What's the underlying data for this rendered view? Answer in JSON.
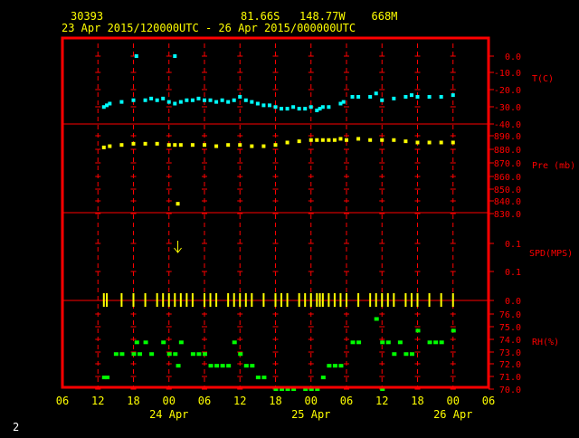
{
  "header": {
    "station": "30393",
    "location": "81.66S   148.77W    668M",
    "period": "23 Apr 2015/120000UTC - 26 Apr 2015/000000UTC"
  },
  "footer": {
    "page_number": "2"
  },
  "colors": {
    "frame": "#ff0000",
    "tick_text": "#ffff00",
    "panel_text": "#ff0000",
    "temperature": "#00ffff",
    "pressure": "#ffff00",
    "wind": "#ffff00",
    "humidity": "#00ff00"
  },
  "chart_data": {
    "type": "scatter",
    "x_unit": "hours since 2015-04-23 06:00 UTC",
    "x_ticks": [
      "06",
      "12",
      "18",
      "00",
      "06",
      "12",
      "18",
      "00",
      "06",
      "12",
      "18",
      "00",
      "06"
    ],
    "x_tick_hours": [
      0,
      6,
      12,
      18,
      24,
      30,
      36,
      42,
      48,
      54,
      60,
      66,
      72
    ],
    "date_labels": [
      {
        "label": "24 Apr",
        "hour": 18
      },
      {
        "label": "25 Apr",
        "hour": 42
      },
      {
        "label": "26 Apr",
        "hour": 66
      }
    ],
    "xlim": [
      0,
      72
    ],
    "panels": [
      {
        "id": "temperature",
        "ylabel": "T(C)",
        "ticks": [
          "0.0",
          "-10.0",
          "-20.0",
          "-30.0",
          "-40.0"
        ],
        "ylim": [
          0,
          -40
        ],
        "series": [
          {
            "color": "#00ffff",
            "points": [
              [
                7,
                -30
              ],
              [
                7.5,
                -29
              ],
              [
                8,
                -28
              ],
              [
                10,
                -27
              ],
              [
                12,
                -26
              ],
              [
                14,
                -26
              ],
              [
                15,
                -25
              ],
              [
                16,
                -26
              ],
              [
                17,
                -25
              ],
              [
                18,
                -27
              ],
              [
                19,
                -28
              ],
              [
                20,
                -27
              ],
              [
                21,
                -26
              ],
              [
                22,
                -26
              ],
              [
                23,
                -25
              ],
              [
                24,
                -26
              ],
              [
                25,
                -26
              ],
              [
                26,
                -27
              ],
              [
                27,
                -26
              ],
              [
                28,
                -27
              ],
              [
                29,
                -26
              ],
              [
                30,
                -24
              ],
              [
                31,
                -26
              ],
              [
                32,
                -27
              ],
              [
                33,
                -28
              ],
              [
                34,
                -29
              ],
              [
                35,
                -29
              ],
              [
                36,
                -30
              ],
              [
                37,
                -31
              ],
              [
                38,
                -31
              ],
              [
                39,
                -30
              ],
              [
                40,
                -31
              ],
              [
                41,
                -31
              ],
              [
                42,
                -30
              ],
              [
                43,
                -32
              ],
              [
                43.5,
                -31
              ],
              [
                44,
                -30
              ],
              [
                45,
                -30
              ],
              [
                47,
                -28
              ],
              [
                47.5,
                -27
              ],
              [
                49,
                -24
              ],
              [
                50,
                -24
              ],
              [
                52,
                -24
              ],
              [
                53,
                -22
              ],
              [
                54,
                -26
              ],
              [
                56,
                -25
              ],
              [
                58,
                -24
              ],
              [
                59,
                -23
              ],
              [
                60,
                -24
              ],
              [
                62,
                -24
              ],
              [
                64,
                -24
              ],
              [
                66,
                -23
              ],
              [
                12.5,
                0
              ],
              [
                19,
                0
              ]
            ]
          }
        ]
      },
      {
        "id": "pressure",
        "ylabel": "Pre (mb)",
        "ticks": [
          "890.0",
          "880.0",
          "870.0",
          "860.0",
          "850.0",
          "840.0",
          "830.0"
        ],
        "ylim": [
          830,
          895
        ],
        "series": [
          {
            "color": "#ffff00",
            "points": [
              [
                7,
                884
              ],
              [
                8,
                885
              ],
              [
                10,
                886
              ],
              [
                12,
                887
              ],
              [
                14,
                887
              ],
              [
                16,
                887
              ],
              [
                18,
                886
              ],
              [
                19,
                886
              ],
              [
                20,
                886
              ],
              [
                22,
                886
              ],
              [
                24,
                886
              ],
              [
                26,
                885
              ],
              [
                28,
                886
              ],
              [
                30,
                886
              ],
              [
                32,
                885
              ],
              [
                34,
                885
              ],
              [
                36,
                886
              ],
              [
                38,
                888
              ],
              [
                40,
                889
              ],
              [
                42,
                890
              ],
              [
                43,
                890
              ],
              [
                44,
                890
              ],
              [
                45,
                890
              ],
              [
                46,
                890
              ],
              [
                47,
                891
              ],
              [
                48,
                890
              ],
              [
                50,
                891
              ],
              [
                52,
                890
              ],
              [
                54,
                890
              ],
              [
                56,
                890
              ],
              [
                58,
                889
              ],
              [
                60,
                888
              ],
              [
                62,
                888
              ],
              [
                64,
                888
              ],
              [
                66,
                888
              ],
              [
                19.5,
                838
              ]
            ]
          }
        ]
      },
      {
        "id": "wind",
        "ylabel": "SPD(MPS)",
        "ticks": [
          "0.1",
          "0.1",
          "0.0"
        ],
        "ylim": [
          0,
          0.1
        ],
        "wind_arrow": {
          "hour": 19.5,
          "direction": "down"
        },
        "bars_hours": [
          7,
          7.5,
          10,
          12,
          14,
          16,
          17,
          18,
          19,
          20,
          21,
          22,
          24,
          25,
          26,
          28,
          29,
          30,
          31,
          32,
          34,
          36,
          37,
          38,
          40,
          41,
          42,
          43,
          43.5,
          44,
          45,
          46,
          47,
          48,
          50,
          52,
          53,
          54,
          55,
          56,
          58,
          59,
          60,
          62,
          64,
          66
        ]
      },
      {
        "id": "humidity",
        "ylabel": "RH(%)",
        "ticks": [
          "76.0",
          "75.0",
          "74.0",
          "73.0",
          "72.0",
          "71.0",
          "70.0"
        ],
        "ylim": [
          70,
          76.5
        ],
        "series": [
          {
            "color": "#00ff00",
            "points": [
              [
                7,
                71
              ],
              [
                7.5,
                71
              ],
              [
                9,
                73
              ],
              [
                10,
                73
              ],
              [
                12,
                73
              ],
              [
                12.5,
                74
              ],
              [
                13,
                73
              ],
              [
                14,
                74
              ],
              [
                15,
                73
              ],
              [
                17,
                74
              ],
              [
                18,
                73
              ],
              [
                19,
                73
              ],
              [
                19.5,
                72
              ],
              [
                20,
                74
              ],
              [
                22,
                73
              ],
              [
                23,
                73
              ],
              [
                24,
                73
              ],
              [
                25,
                72
              ],
              [
                26,
                72
              ],
              [
                27,
                72
              ],
              [
                28,
                72
              ],
              [
                29,
                74
              ],
              [
                30,
                73
              ],
              [
                31,
                72
              ],
              [
                32,
                72
              ],
              [
                33,
                71
              ],
              [
                34,
                71
              ],
              [
                36,
                70
              ],
              [
                37,
                70
              ],
              [
                38,
                70
              ],
              [
                39,
                70
              ],
              [
                41,
                70
              ],
              [
                42,
                70
              ],
              [
                43,
                70
              ],
              [
                44,
                71
              ],
              [
                45,
                72
              ],
              [
                46,
                72
              ],
              [
                47,
                72
              ],
              [
                49,
                74
              ],
              [
                50,
                74
              ],
              [
                53,
                76
              ],
              [
                54,
                70
              ],
              [
                54,
                74
              ],
              [
                55,
                74
              ],
              [
                56,
                73
              ],
              [
                57,
                74
              ],
              [
                58,
                73
              ],
              [
                59,
                73
              ],
              [
                60,
                75
              ],
              [
                62,
                74
              ],
              [
                63,
                74
              ],
              [
                64,
                74
              ],
              [
                66,
                75
              ]
            ]
          }
        ]
      }
    ]
  }
}
